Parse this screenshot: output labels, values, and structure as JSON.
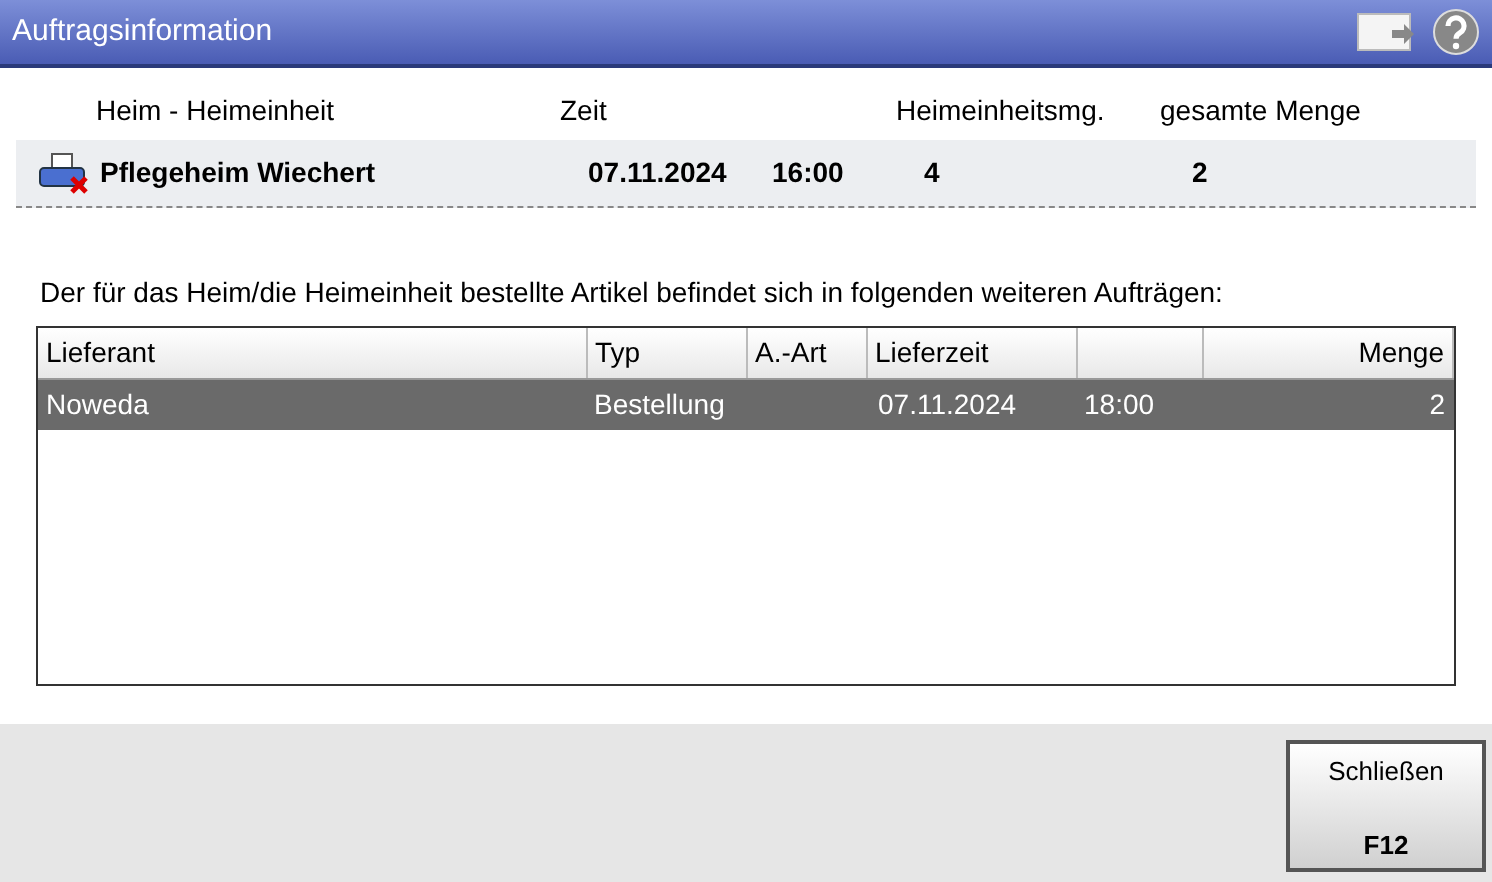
{
  "window": {
    "title": "Auftragsinformation"
  },
  "order": {
    "columns": [
      "Heim - Heimeinheit",
      "Zeit",
      "Heimeinheitsmg.",
      "gesamte Menge"
    ],
    "row": {
      "home": "Pflegeheim Wiechert",
      "date": "07.11.2024",
      "time": "16:00",
      "unit_quantity": "4",
      "total_quantity": "2"
    }
  },
  "message": "Der für das Heim/die Heimeinheit bestellte Artikel befindet sich in folgenden weiteren Aufträgen:",
  "table": {
    "columns": [
      "Lieferant",
      "Typ",
      "A.-Art",
      "Lieferzeit",
      "",
      "Menge"
    ],
    "rows": [
      {
        "cells": [
          "Noweda",
          "Bestellung",
          "",
          "07.11.2024",
          "18:00",
          "2"
        ],
        "selected": true
      }
    ]
  },
  "buttons": [
    {
      "label": "Schließen",
      "key": "F12"
    }
  ]
}
